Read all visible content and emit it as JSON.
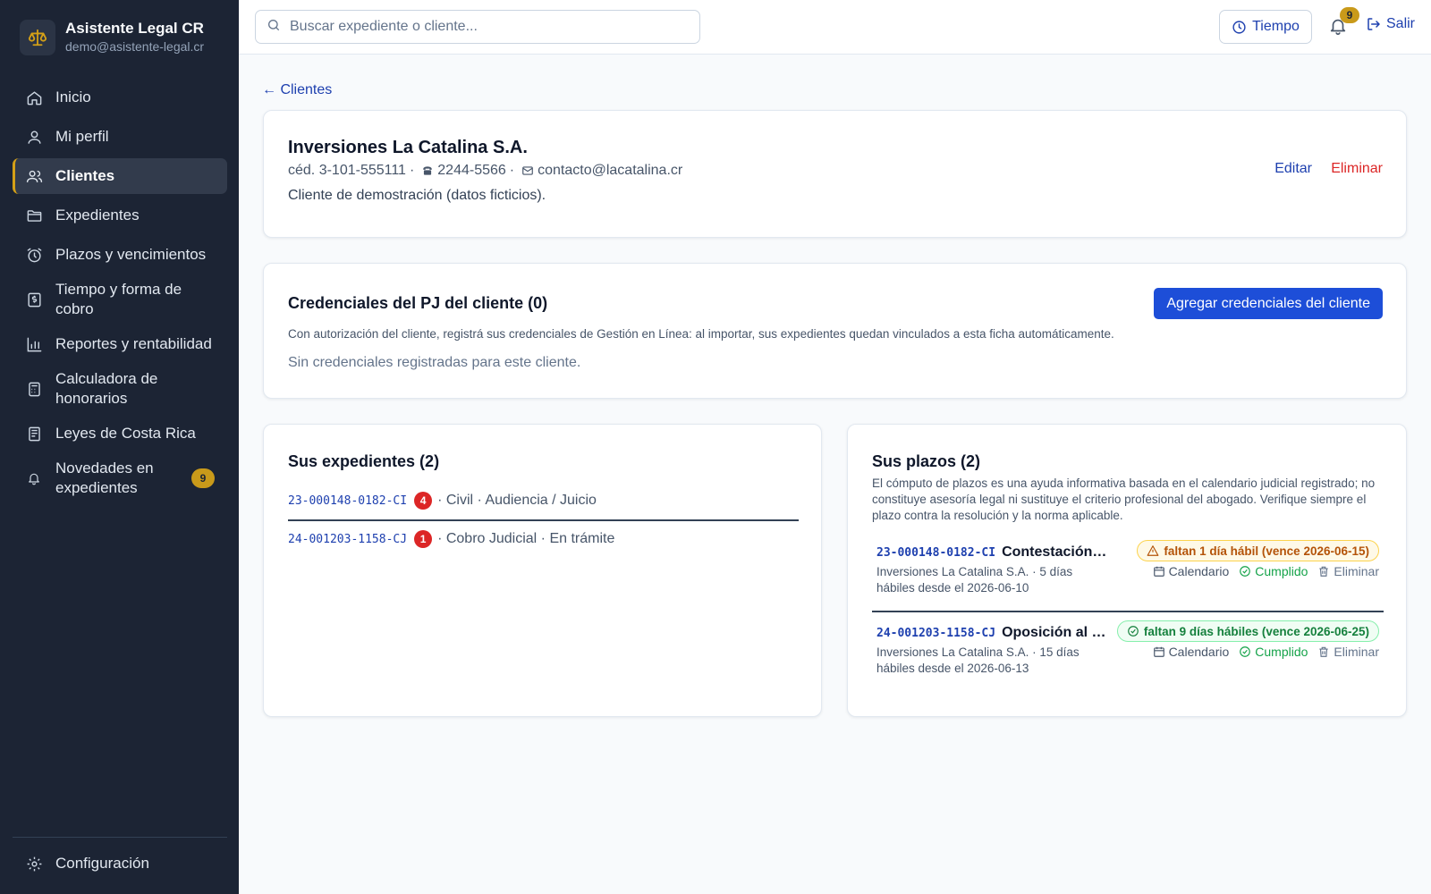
{
  "app": {
    "name": "Asistente Legal CR",
    "user_email": "demo@asistente-legal.cr"
  },
  "colors": {
    "sidebar_bg": "#1c2434",
    "accent_gold": "#c99a1a",
    "primary_blue": "#1d4ed8",
    "danger": "#dc2626",
    "success": "#16a34a"
  },
  "sidebar": {
    "items": [
      {
        "label": "Inicio",
        "icon": "home-icon"
      },
      {
        "label": "Mi perfil",
        "icon": "user-icon"
      },
      {
        "label": "Clientes",
        "icon": "users-icon",
        "active": true
      },
      {
        "label": "Expedientes",
        "icon": "folder-icon"
      },
      {
        "label": "Plazos y vencimientos",
        "icon": "alarm-icon"
      },
      {
        "label": "Tiempo y forma de cobro",
        "icon": "billing-icon"
      },
      {
        "label": "Reportes y rentabilidad",
        "icon": "bar-chart-icon"
      },
      {
        "label": "Calculadora de honorarios",
        "icon": "calculator-icon"
      },
      {
        "label": "Leyes de Costa Rica",
        "icon": "book-icon"
      },
      {
        "label": "Novedades en expedientes",
        "icon": "bell-icon",
        "badge": "9"
      }
    ],
    "settings_label": "Configuración"
  },
  "topbar": {
    "search_placeholder": "Buscar expediente o cliente...",
    "time_button": "Tiempo",
    "notifications_count": "9",
    "logout": "Salir"
  },
  "back_link": "← Clientes",
  "client": {
    "name": "Inversiones La Catalina S.A.",
    "id": "céd. 3-101-555111",
    "phone": "2244-5566",
    "email": "contacto@lacatalina.cr",
    "description": "Cliente de demostración (datos ficticios).",
    "edit_label": "Editar",
    "delete_label": "Eliminar"
  },
  "credentials": {
    "title": "Credenciales del PJ del cliente (0)",
    "add_button": "Agregar credenciales del cliente",
    "help": "Con autorización del cliente, registrá sus credenciales de Gestión en Línea: al importar, sus expedientes quedan vinculados a esta ficha automáticamente.",
    "empty": "Sin credenciales registradas para este cliente."
  },
  "expedientes": {
    "title": "Sus expedientes (2)",
    "items": [
      {
        "code": "23-000148-0182-CI",
        "count": "4",
        "detail": "· Civil · Audiencia / Juicio"
      },
      {
        "code": "24-001203-1158-CJ",
        "count": "1",
        "detail": "· Cobro Judicial · En trámite"
      }
    ]
  },
  "plazos": {
    "title": "Sus plazos (2)",
    "note": "El cómputo de plazos es una ayuda informativa basada en el calendario judicial registrado; no constituye asesoría legal ni sustituye el criterio profesional del abogado. Verifique siempre el plazo contra la resolución y la norma aplicable.",
    "items": [
      {
        "code": "23-000148-0182-CI",
        "name": "Contestación de la demanda",
        "subtitle": "Inversiones La Catalina S.A. · 5 días hábiles desde el 2026-06-10",
        "status": "faltan 1 día hábil (vence 2026-06-15)",
        "status_kind": "warning",
        "calendar": "Calendario",
        "done": "Cumplido",
        "delete": "Eliminar"
      },
      {
        "code": "24-001203-1158-CJ",
        "name": "Oposición al cobro",
        "subtitle": "Inversiones La Catalina S.A. · 15 días hábiles desde el 2026-06-13",
        "status": "faltan 9 días hábiles (vence 2026-06-25)",
        "status_kind": "ok",
        "calendar": "Calendario",
        "done": "Cumplido",
        "delete": "Eliminar"
      }
    ]
  }
}
